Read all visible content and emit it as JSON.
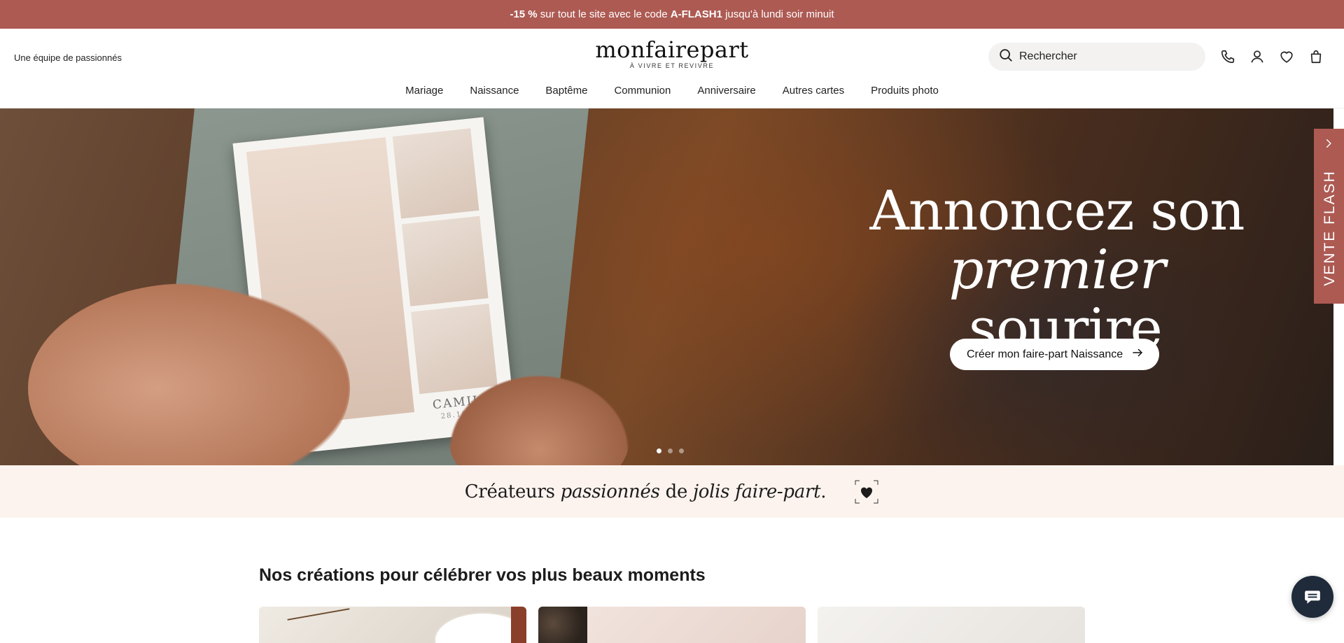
{
  "promo": {
    "discount": "-15 %",
    "text_before_code": " sur tout le site avec le code ",
    "code": "A-FLASH1",
    "text_after_code": " jusqu'à lundi soir minuit"
  },
  "header": {
    "tagline": "Une équipe de passionnés",
    "logo": "monfairepart",
    "logo_subtitle": "À VIVRE ET REVIVRE",
    "search_placeholder": "Rechercher",
    "icons": [
      "phone-icon",
      "account-icon",
      "heart-icon",
      "bag-icon"
    ]
  },
  "nav": {
    "items": [
      "Mariage",
      "Naissance",
      "Baptême",
      "Communion",
      "Anniversaire",
      "Autres cartes",
      "Produits photo"
    ]
  },
  "hero": {
    "title_line1": "Annoncez son",
    "title_emph": "premier",
    "title_line2_rest": " sourire",
    "cta_label": "Créer mon faire-part Naissance",
    "card_name": "CAMILLE",
    "card_date": "28.10.2024",
    "slides_count": 3,
    "active_slide": 1
  },
  "side_tab": {
    "label": "VENTE FLASH"
  },
  "banner": {
    "text_1": "Créateurs ",
    "text_emph_1": "passionnés",
    "text_2": " de ",
    "text_emph_2": "jolis faire-part",
    "text_3": "."
  },
  "section": {
    "title": "Nos créations pour célébrer vos plus beaux moments"
  },
  "colors": {
    "brand": "#ad5a53",
    "banner_bg": "#fcf3ee",
    "chat_bg": "#1f2a3a"
  }
}
